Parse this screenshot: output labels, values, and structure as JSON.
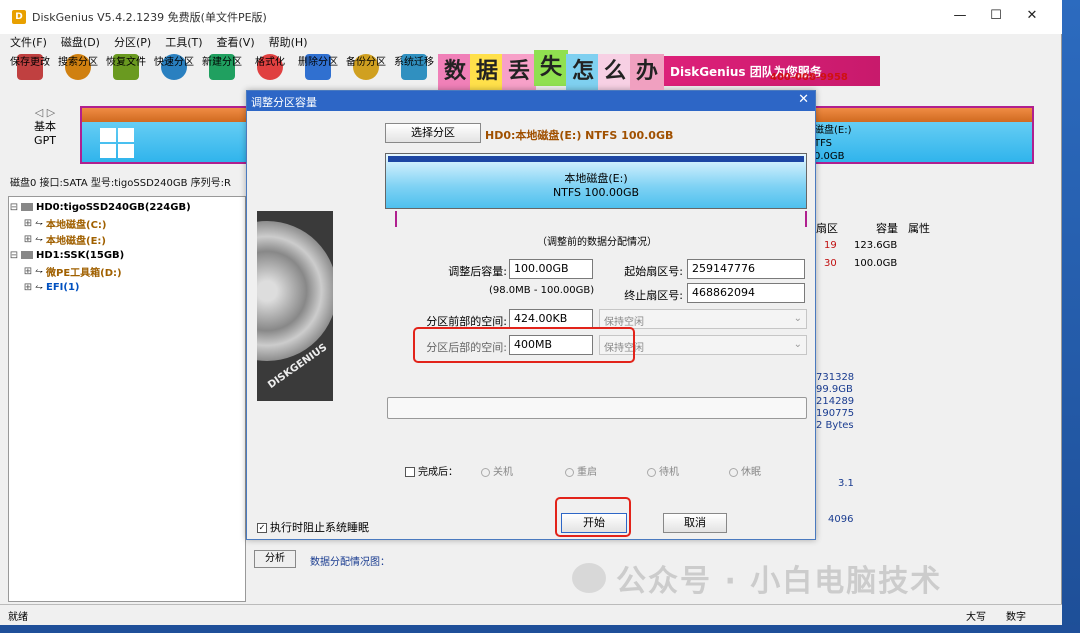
{
  "app": {
    "title": "DiskGenius V5.4.2.1239 免费版(单文件PE版)",
    "icon_letter": "D"
  },
  "menu": [
    "文件(F)",
    "磁盘(D)",
    "分区(P)",
    "工具(T)",
    "查看(V)",
    "帮助(H)"
  ],
  "toolbar": [
    {
      "label": "保存更改",
      "color": "#c04040"
    },
    {
      "label": "搜索分区",
      "color": "#d08010"
    },
    {
      "label": "恢复文件",
      "color": "#6a9a20"
    },
    {
      "label": "快速分区",
      "color": "#2a80c0"
    },
    {
      "label": "新建分区",
      "color": "#20a060"
    },
    {
      "label": "格式化",
      "color": "#e04040"
    },
    {
      "label": "删除分区",
      "color": "#3070d0"
    },
    {
      "label": "备份分区",
      "color": "#d0a020"
    },
    {
      "label": "系统迁移",
      "color": "#3090c0"
    }
  ],
  "banner": {
    "chars": [
      "数",
      "据",
      "丢",
      "失",
      "怎",
      "么",
      "办"
    ],
    "text": "DiskGenius 团队为您服务",
    "phone": "400-008-9958"
  },
  "diskbar": {
    "basic": "基本",
    "gpt": "GPT",
    "right_label_1": "磁盘(E:)",
    "right_label_2": "TFS",
    "right_label_3": "0.0GB"
  },
  "diskinfo": "磁盘0 接口:SATA  型号:tigoSSD240GB  序列号:R",
  "tree": [
    {
      "text": "HD0:tigoSSD240GB(224GB)",
      "level": 0,
      "kind": "disk"
    },
    {
      "text": "本地磁盘(C:)",
      "level": 1,
      "kind": "part"
    },
    {
      "text": "本地磁盘(E:)",
      "level": 1,
      "kind": "part"
    },
    {
      "text": "HD1:SSK(15GB)",
      "level": 0,
      "kind": "disk"
    },
    {
      "text": "微PE工具箱(D:)",
      "level": 1,
      "kind": "part"
    },
    {
      "text": "EFI(1)",
      "level": 1,
      "kind": "efi"
    }
  ],
  "right_info": {
    "col_sector": "扇区",
    "col_capacity": "容量",
    "col_attr": "属性",
    "rows": [
      {
        "sector": "19",
        "capacity": "123.6GB"
      },
      {
        "sector": "30",
        "capacity": "100.0GB"
      }
    ],
    "values": [
      "731328",
      "99.9GB",
      "214289",
      "190775",
      "2 Bytes"
    ],
    "val_31": "3.1",
    "val_4096": "4096"
  },
  "bottom": {
    "analyze": "分析",
    "analyze_text": "数据分配情况图："
  },
  "status": {
    "left": "就绪",
    "caps": "大写",
    "num": "数字"
  },
  "dialog": {
    "title": "调整分区容量",
    "select_btn": "选择分区",
    "selected": "HD0:本地磁盘(E:) NTFS 100.0GB",
    "part_name": "本地磁盘(E:)",
    "part_fs": "NTFS 100.00GB",
    "before_label": "（调整前的数据分配情况）",
    "size_label": "调整后容量:",
    "size_value": "100.00GB",
    "range": "(98.0MB - 100.00GB)",
    "start_label": "起始扇区号:",
    "start_value": "259147776",
    "end_label": "终止扇区号:",
    "end_value": "468862094",
    "before_space_label": "分区前部的空间:",
    "before_space_value": "424.00KB",
    "before_space_opt": "保持空闲",
    "after_space_label": "分区后部的空间:",
    "after_space_value": "400MB",
    "after_space_opt": "保持空闲",
    "finish_label": "完成后：",
    "options": [
      "关机",
      "重启",
      "待机",
      "休眠"
    ],
    "prevent_sleep": "执行时阻止系统睡眠",
    "start_btn": "开始",
    "cancel_btn": "取消",
    "hdd_logo": "DISKGENIUS"
  },
  "watermark": "公众号 · 小白电脑技术"
}
